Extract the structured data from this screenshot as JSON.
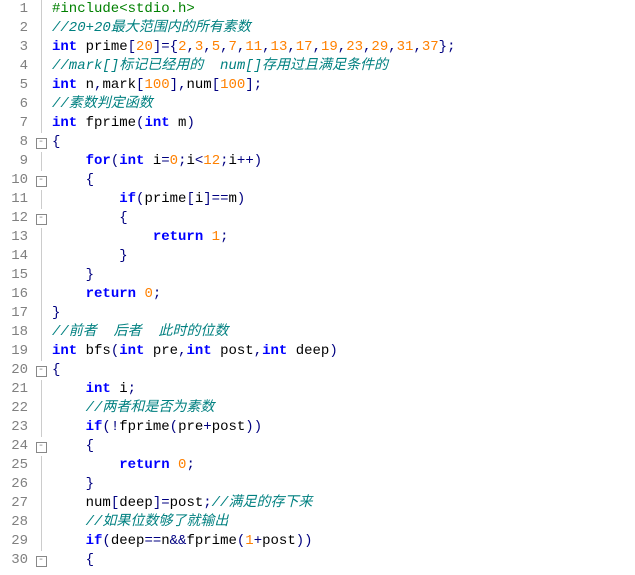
{
  "line_numbers": [
    "1",
    "2",
    "3",
    "4",
    "5",
    "6",
    "7",
    "8",
    "9",
    "10",
    "11",
    "12",
    "13",
    "14",
    "15",
    "16",
    "17",
    "18",
    "19",
    "20",
    "21",
    "22",
    "23",
    "24",
    "25",
    "26",
    "27",
    "28",
    "29",
    "30"
  ],
  "fold_markers": [
    "",
    "",
    "",
    "",
    "",
    "",
    "",
    "⊟",
    "",
    "⊟",
    "",
    "⊟",
    "",
    "",
    "",
    "",
    "",
    "",
    "",
    "⊟",
    "",
    "",
    "",
    "⊟",
    "",
    "",
    "",
    "",
    "",
    "⊟"
  ],
  "lines": [
    {
      "segments": [
        {
          "c": "pp",
          "t": "#include<stdio.h>"
        }
      ]
    },
    {
      "segments": [
        {
          "c": "cm",
          "t": "//20+20最大范围内的所有素数"
        }
      ]
    },
    {
      "segments": [
        {
          "c": "kw",
          "t": "int"
        },
        {
          "c": "id",
          "t": " prime"
        },
        {
          "c": "op",
          "t": "["
        },
        {
          "c": "num",
          "t": "20"
        },
        {
          "c": "op",
          "t": "]={"
        },
        {
          "c": "num",
          "t": "2"
        },
        {
          "c": "op",
          "t": ","
        },
        {
          "c": "num",
          "t": "3"
        },
        {
          "c": "op",
          "t": ","
        },
        {
          "c": "num",
          "t": "5"
        },
        {
          "c": "op",
          "t": ","
        },
        {
          "c": "num",
          "t": "7"
        },
        {
          "c": "op",
          "t": ","
        },
        {
          "c": "num",
          "t": "11"
        },
        {
          "c": "op",
          "t": ","
        },
        {
          "c": "num",
          "t": "13"
        },
        {
          "c": "op",
          "t": ","
        },
        {
          "c": "num",
          "t": "17"
        },
        {
          "c": "op",
          "t": ","
        },
        {
          "c": "num",
          "t": "19"
        },
        {
          "c": "op",
          "t": ","
        },
        {
          "c": "num",
          "t": "23"
        },
        {
          "c": "op",
          "t": ","
        },
        {
          "c": "num",
          "t": "29"
        },
        {
          "c": "op",
          "t": ","
        },
        {
          "c": "num",
          "t": "31"
        },
        {
          "c": "op",
          "t": ","
        },
        {
          "c": "num",
          "t": "37"
        },
        {
          "c": "op",
          "t": "};"
        }
      ]
    },
    {
      "segments": [
        {
          "c": "cm",
          "t": "//mark[]标记已经用的  num[]存用过且满足条件的"
        }
      ]
    },
    {
      "segments": [
        {
          "c": "kw",
          "t": "int"
        },
        {
          "c": "id",
          "t": " n"
        },
        {
          "c": "op",
          "t": ","
        },
        {
          "c": "id",
          "t": "mark"
        },
        {
          "c": "op",
          "t": "["
        },
        {
          "c": "num",
          "t": "100"
        },
        {
          "c": "op",
          "t": "],"
        },
        {
          "c": "id",
          "t": "num"
        },
        {
          "c": "op",
          "t": "["
        },
        {
          "c": "num",
          "t": "100"
        },
        {
          "c": "op",
          "t": "];"
        }
      ]
    },
    {
      "segments": [
        {
          "c": "cm",
          "t": "//素数判定函数"
        }
      ]
    },
    {
      "segments": [
        {
          "c": "kw",
          "t": "int"
        },
        {
          "c": "id",
          "t": " fprime"
        },
        {
          "c": "op",
          "t": "("
        },
        {
          "c": "kw",
          "t": "int"
        },
        {
          "c": "id",
          "t": " m"
        },
        {
          "c": "op",
          "t": ")"
        }
      ]
    },
    {
      "segments": [
        {
          "c": "op",
          "t": "{"
        }
      ]
    },
    {
      "segments": [
        {
          "c": "id",
          "t": "    "
        },
        {
          "c": "kw",
          "t": "for"
        },
        {
          "c": "op",
          "t": "("
        },
        {
          "c": "kw",
          "t": "int"
        },
        {
          "c": "id",
          "t": " i"
        },
        {
          "c": "op",
          "t": "="
        },
        {
          "c": "num",
          "t": "0"
        },
        {
          "c": "op",
          "t": ";"
        },
        {
          "c": "id",
          "t": "i"
        },
        {
          "c": "op",
          "t": "<"
        },
        {
          "c": "num",
          "t": "12"
        },
        {
          "c": "op",
          "t": ";"
        },
        {
          "c": "id",
          "t": "i"
        },
        {
          "c": "op",
          "t": "++)"
        }
      ]
    },
    {
      "segments": [
        {
          "c": "op",
          "t": "    {"
        }
      ]
    },
    {
      "segments": [
        {
          "c": "id",
          "t": "        "
        },
        {
          "c": "kw",
          "t": "if"
        },
        {
          "c": "op",
          "t": "("
        },
        {
          "c": "id",
          "t": "prime"
        },
        {
          "c": "op",
          "t": "["
        },
        {
          "c": "id",
          "t": "i"
        },
        {
          "c": "op",
          "t": "]=="
        },
        {
          "c": "id",
          "t": "m"
        },
        {
          "c": "op",
          "t": ")"
        }
      ]
    },
    {
      "segments": [
        {
          "c": "op",
          "t": "        {"
        }
      ]
    },
    {
      "segments": [
        {
          "c": "id",
          "t": "            "
        },
        {
          "c": "kw",
          "t": "return"
        },
        {
          "c": "id",
          "t": " "
        },
        {
          "c": "num",
          "t": "1"
        },
        {
          "c": "op",
          "t": ";"
        }
      ]
    },
    {
      "segments": [
        {
          "c": "op",
          "t": "        }"
        }
      ]
    },
    {
      "segments": [
        {
          "c": "op",
          "t": "    }"
        }
      ]
    },
    {
      "segments": [
        {
          "c": "id",
          "t": "    "
        },
        {
          "c": "kw",
          "t": "return"
        },
        {
          "c": "id",
          "t": " "
        },
        {
          "c": "num",
          "t": "0"
        },
        {
          "c": "op",
          "t": ";"
        }
      ]
    },
    {
      "segments": [
        {
          "c": "op",
          "t": "}"
        }
      ]
    },
    {
      "segments": [
        {
          "c": "cm",
          "t": "//前者  后者  此时的位数"
        }
      ]
    },
    {
      "segments": [
        {
          "c": "kw",
          "t": "int"
        },
        {
          "c": "id",
          "t": " bfs"
        },
        {
          "c": "op",
          "t": "("
        },
        {
          "c": "kw",
          "t": "int"
        },
        {
          "c": "id",
          "t": " pre"
        },
        {
          "c": "op",
          "t": ","
        },
        {
          "c": "kw",
          "t": "int"
        },
        {
          "c": "id",
          "t": " post"
        },
        {
          "c": "op",
          "t": ","
        },
        {
          "c": "kw",
          "t": "int"
        },
        {
          "c": "id",
          "t": " deep"
        },
        {
          "c": "op",
          "t": ")"
        }
      ]
    },
    {
      "segments": [
        {
          "c": "op",
          "t": "{"
        }
      ]
    },
    {
      "segments": [
        {
          "c": "id",
          "t": "    "
        },
        {
          "c": "kw",
          "t": "int"
        },
        {
          "c": "id",
          "t": " i"
        },
        {
          "c": "op",
          "t": ";"
        }
      ]
    },
    {
      "segments": [
        {
          "c": "id",
          "t": "    "
        },
        {
          "c": "cm",
          "t": "//两者和是否为素数"
        }
      ]
    },
    {
      "segments": [
        {
          "c": "id",
          "t": "    "
        },
        {
          "c": "kw",
          "t": "if"
        },
        {
          "c": "op",
          "t": "(!"
        },
        {
          "c": "id",
          "t": "fprime"
        },
        {
          "c": "op",
          "t": "("
        },
        {
          "c": "id",
          "t": "pre"
        },
        {
          "c": "op",
          "t": "+"
        },
        {
          "c": "id",
          "t": "post"
        },
        {
          "c": "op",
          "t": "))"
        }
      ]
    },
    {
      "segments": [
        {
          "c": "op",
          "t": "    {"
        }
      ]
    },
    {
      "segments": [
        {
          "c": "id",
          "t": "        "
        },
        {
          "c": "kw",
          "t": "return"
        },
        {
          "c": "id",
          "t": " "
        },
        {
          "c": "num",
          "t": "0"
        },
        {
          "c": "op",
          "t": ";"
        }
      ]
    },
    {
      "segments": [
        {
          "c": "op",
          "t": "    }"
        }
      ]
    },
    {
      "segments": [
        {
          "c": "id",
          "t": "    num"
        },
        {
          "c": "op",
          "t": "["
        },
        {
          "c": "id",
          "t": "deep"
        },
        {
          "c": "op",
          "t": "]="
        },
        {
          "c": "id",
          "t": "post"
        },
        {
          "c": "op",
          "t": ";"
        },
        {
          "c": "cm",
          "t": "//满足的存下来"
        }
      ]
    },
    {
      "segments": [
        {
          "c": "id",
          "t": "    "
        },
        {
          "c": "cm",
          "t": "//如果位数够了就输出"
        }
      ]
    },
    {
      "segments": [
        {
          "c": "id",
          "t": "    "
        },
        {
          "c": "kw",
          "t": "if"
        },
        {
          "c": "op",
          "t": "("
        },
        {
          "c": "id",
          "t": "deep"
        },
        {
          "c": "op",
          "t": "=="
        },
        {
          "c": "id",
          "t": "n"
        },
        {
          "c": "op",
          "t": "&&"
        },
        {
          "c": "id",
          "t": "fprime"
        },
        {
          "c": "op",
          "t": "("
        },
        {
          "c": "num",
          "t": "1"
        },
        {
          "c": "op",
          "t": "+"
        },
        {
          "c": "id",
          "t": "post"
        },
        {
          "c": "op",
          "t": "))"
        }
      ]
    },
    {
      "segments": [
        {
          "c": "op",
          "t": "    {"
        }
      ]
    }
  ]
}
